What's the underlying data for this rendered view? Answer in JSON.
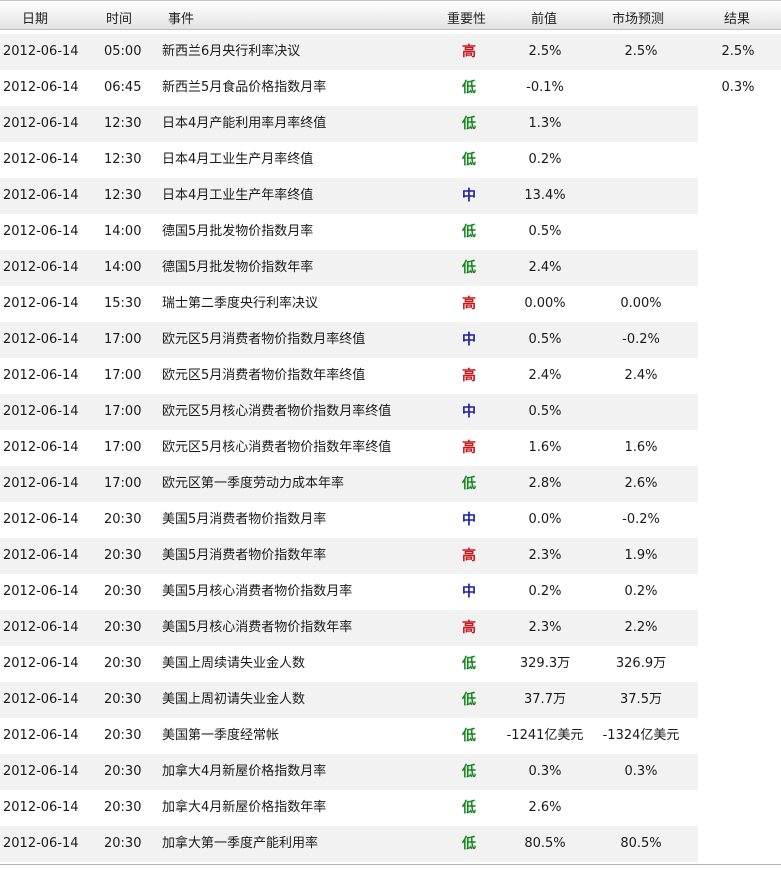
{
  "columns": {
    "date": "日期",
    "time": "时间",
    "event": "事件",
    "importance": "重要性",
    "previous": "前值",
    "forecast": "市场预测",
    "actual": "结果"
  },
  "importance_colors": {
    "高": "#c8161d",
    "中": "#1c1ca8",
    "低": "#16871e"
  },
  "rows": [
    {
      "date": "2012-06-14",
      "time": "05:00",
      "event": "新西兰6月央行利率决议",
      "importance": "高",
      "previous": "2.5%",
      "forecast": "2.5%",
      "actual": "2.5%"
    },
    {
      "date": "2012-06-14",
      "time": "06:45",
      "event": "新西兰5月食品价格指数月率",
      "importance": "低",
      "previous": "-0.1%",
      "forecast": "",
      "actual": "0.3%"
    },
    {
      "date": "2012-06-14",
      "time": "12:30",
      "event": "日本4月产能利用率月率终值",
      "importance": "低",
      "previous": "1.3%",
      "forecast": "",
      "actual": ""
    },
    {
      "date": "2012-06-14",
      "time": "12:30",
      "event": "日本4月工业生产月率终值",
      "importance": "低",
      "previous": "0.2%",
      "forecast": "",
      "actual": ""
    },
    {
      "date": "2012-06-14",
      "time": "12:30",
      "event": "日本4月工业生产年率终值",
      "importance": "中",
      "previous": "13.4%",
      "forecast": "",
      "actual": ""
    },
    {
      "date": "2012-06-14",
      "time": "14:00",
      "event": "德国5月批发物价指数月率",
      "importance": "低",
      "previous": "0.5%",
      "forecast": "",
      "actual": ""
    },
    {
      "date": "2012-06-14",
      "time": "14:00",
      "event": "德国5月批发物价指数年率",
      "importance": "低",
      "previous": "2.4%",
      "forecast": "",
      "actual": ""
    },
    {
      "date": "2012-06-14",
      "time": "15:30",
      "event": "瑞士第二季度央行利率决议",
      "importance": "高",
      "previous": "0.00%",
      "forecast": "0.00%",
      "actual": ""
    },
    {
      "date": "2012-06-14",
      "time": "17:00",
      "event": "欧元区5月消费者物价指数月率终值",
      "importance": "中",
      "previous": "0.5%",
      "forecast": "-0.2%",
      "actual": ""
    },
    {
      "date": "2012-06-14",
      "time": "17:00",
      "event": "欧元区5月消费者物价指数年率终值",
      "importance": "高",
      "previous": "2.4%",
      "forecast": "2.4%",
      "actual": ""
    },
    {
      "date": "2012-06-14",
      "time": "17:00",
      "event": "欧元区5月核心消费者物价指数月率终值",
      "importance": "中",
      "previous": "0.5%",
      "forecast": "",
      "actual": ""
    },
    {
      "date": "2012-06-14",
      "time": "17:00",
      "event": "欧元区5月核心消费者物价指数年率终值",
      "importance": "高",
      "previous": "1.6%",
      "forecast": "1.6%",
      "actual": ""
    },
    {
      "date": "2012-06-14",
      "time": "17:00",
      "event": "欧元区第一季度劳动力成本年率",
      "importance": "低",
      "previous": "2.8%",
      "forecast": "2.6%",
      "actual": ""
    },
    {
      "date": "2012-06-14",
      "time": "20:30",
      "event": "美国5月消费者物价指数月率",
      "importance": "中",
      "previous": "0.0%",
      "forecast": "-0.2%",
      "actual": ""
    },
    {
      "date": "2012-06-14",
      "time": "20:30",
      "event": "美国5月消费者物价指数年率",
      "importance": "高",
      "previous": "2.3%",
      "forecast": "1.9%",
      "actual": ""
    },
    {
      "date": "2012-06-14",
      "time": "20:30",
      "event": "美国5月核心消费者物价指数月率",
      "importance": "中",
      "previous": "0.2%",
      "forecast": "0.2%",
      "actual": ""
    },
    {
      "date": "2012-06-14",
      "time": "20:30",
      "event": "美国5月核心消费者物价指数年率",
      "importance": "高",
      "previous": "2.3%",
      "forecast": "2.2%",
      "actual": ""
    },
    {
      "date": "2012-06-14",
      "time": "20:30",
      "event": "美国上周续请失业金人数",
      "importance": "低",
      "previous": "329.3万",
      "forecast": "326.9万",
      "actual": ""
    },
    {
      "date": "2012-06-14",
      "time": "20:30",
      "event": "美国上周初请失业金人数",
      "importance": "低",
      "previous": "37.7万",
      "forecast": "37.5万",
      "actual": ""
    },
    {
      "date": "2012-06-14",
      "time": "20:30",
      "event": "美国第一季度经常帐",
      "importance": "低",
      "previous": "-1241亿美元",
      "forecast": "-1324亿美元",
      "actual": ""
    },
    {
      "date": "2012-06-14",
      "time": "20:30",
      "event": "加拿大4月新屋价格指数月率",
      "importance": "低",
      "previous": "0.3%",
      "forecast": "0.3%",
      "actual": ""
    },
    {
      "date": "2012-06-14",
      "time": "20:30",
      "event": "加拿大4月新屋价格指数年率",
      "importance": "低",
      "previous": "2.6%",
      "forecast": "",
      "actual": ""
    },
    {
      "date": "2012-06-14",
      "time": "20:30",
      "event": "加拿大第一季度产能利用率",
      "importance": "低",
      "previous": "80.5%",
      "forecast": "80.5%",
      "actual": ""
    }
  ]
}
